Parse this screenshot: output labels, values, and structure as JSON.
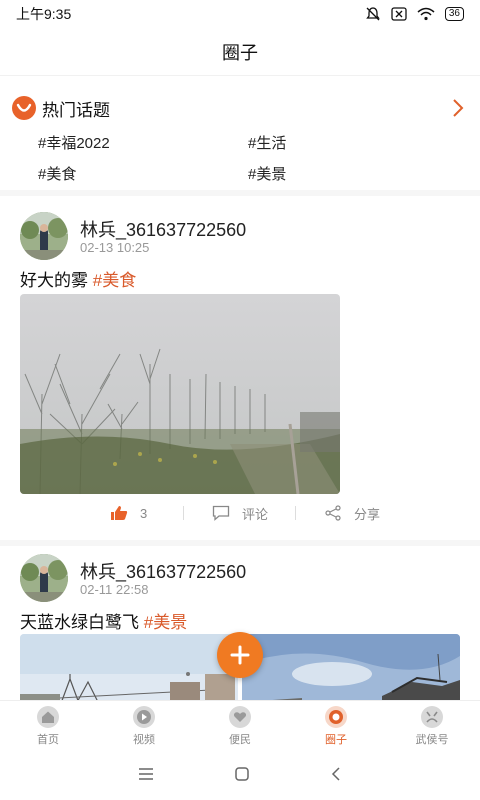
{
  "status": {
    "time": "上午9:35",
    "battery": "36"
  },
  "header": {
    "title": "圈子"
  },
  "hot_topics": {
    "title": "热门话题",
    "tags": [
      "#幸福2022",
      "#生活",
      "#美食",
      "#美景"
    ]
  },
  "posts": [
    {
      "user": "林兵_361637722560",
      "time": "02-13 10:25",
      "text": "好大的雾",
      "tag": "#美食",
      "likes": "3",
      "comment_label": "评论",
      "share_label": "分享"
    },
    {
      "user": "林兵_361637722560",
      "time": "02-11 22:58",
      "text": "天蓝水绿白鹭飞",
      "tag": "#美景"
    }
  ],
  "tabs": [
    {
      "label": "首页",
      "icon": "home-icon"
    },
    {
      "label": "视频",
      "icon": "play-icon"
    },
    {
      "label": "便民",
      "icon": "heart-icon"
    },
    {
      "label": "圈子",
      "icon": "circle-icon",
      "active": true
    },
    {
      "label": "武侯号",
      "icon": "profile-icon"
    }
  ],
  "colors": {
    "accent": "#e0612b",
    "fab": "#f07a22"
  }
}
